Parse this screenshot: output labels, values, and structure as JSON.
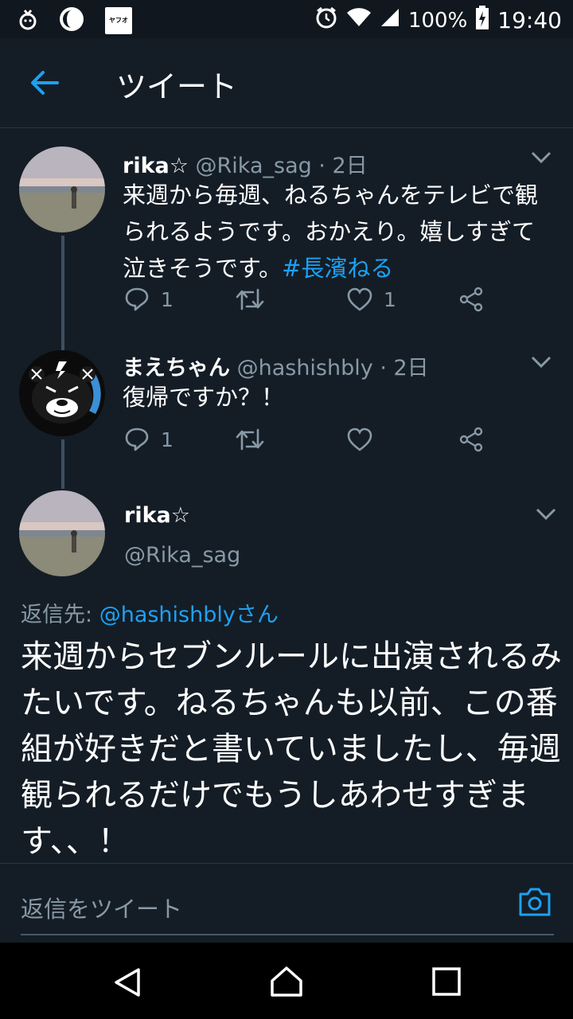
{
  "status_bar": {
    "battery": "100%",
    "time": "19:40",
    "app_badge": "ヤフオク!"
  },
  "header": {
    "title": "ツイート"
  },
  "tweets": [
    {
      "name": "rika☆",
      "handle": "@Rika_sag",
      "time": "· 2日",
      "text_main": "来週から毎週、ねるちゃんをテレビで観られるようです。おかえり。嬉しすぎて泣きそうです。",
      "hashtag": "#長濱ねる",
      "reply_count": "1",
      "like_count": "1"
    },
    {
      "name": "まえちゃん",
      "handle": "@hashishbly",
      "time": "· 2日",
      "text_main": "復帰ですか？！",
      "reply_count": "1",
      "like_count": ""
    }
  ],
  "focused_tweet": {
    "name": "rika☆",
    "handle": "@Rika_sag",
    "reply_to_label": "返信先:",
    "reply_to_user": "@hashishblyさん",
    "text": "来週からセブンルールに出演されるみたいです。ねるちゃんも以前、この番組が好きだと書いていましたし、毎週観られるだけでもうしあわせすぎます、、！"
  },
  "composer": {
    "placeholder": "返信をツイート"
  },
  "colors": {
    "accent": "#1da1f2",
    "background": "#141d26",
    "muted": "#8899a6"
  }
}
